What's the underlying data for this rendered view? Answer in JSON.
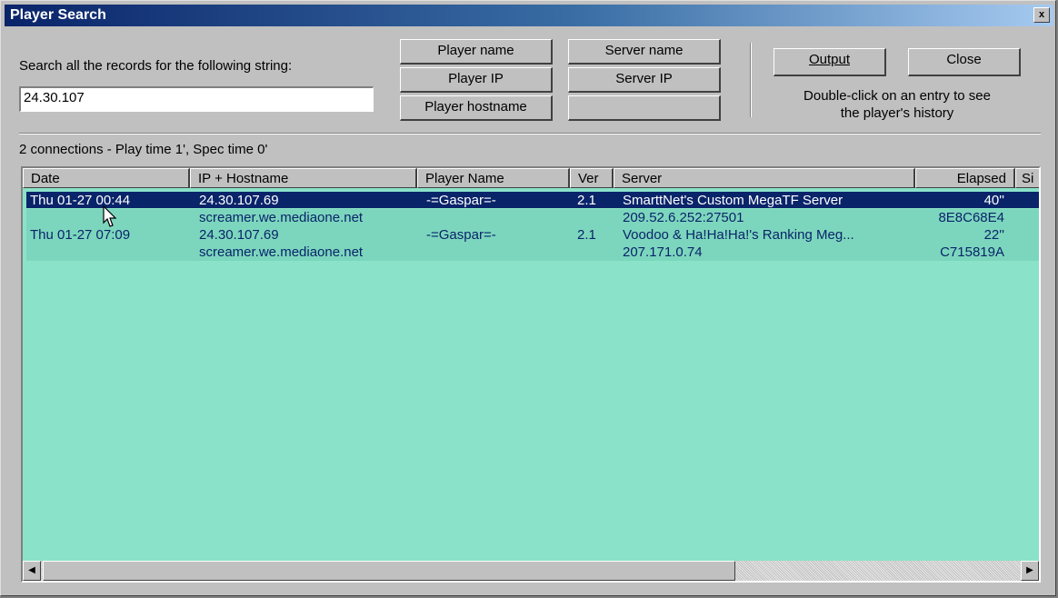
{
  "window": {
    "title": "Player Search",
    "close_glyph": "x"
  },
  "search": {
    "label": "Search all the records for the following string:",
    "value": "24.30.107"
  },
  "buttons": {
    "player_name": "Player name",
    "player_ip": "Player IP",
    "player_hostname": "Player hostname",
    "server_name": "Server name",
    "server_ip": "Server IP",
    "blank": "",
    "output": "Output",
    "close": "Close"
  },
  "hint": "Double-click on an entry to see\nthe player's history",
  "status": "2 connections - Play time 1', Spec time 0'",
  "columns": [
    "Date",
    "IP + Hostname",
    "Player Name",
    "Ver",
    "Server",
    "Elapsed",
    "Si"
  ],
  "rows": [
    {
      "date": "Thu 01-27 00:44",
      "ip": "24.30.107.69",
      "hostname": "screamer.we.mediaone.net",
      "player": "-=Gaspar=-",
      "ver": "2.1",
      "server": "SmarttNet's Custom MegaTF Server",
      "server_ip": "209.52.6.252:27501",
      "elapsed": "40''",
      "id": "8E8C68E4",
      "selected": true
    },
    {
      "date": "Thu 01-27 07:09",
      "ip": "24.30.107.69",
      "hostname": "screamer.we.mediaone.net",
      "player": "-=Gaspar=-",
      "ver": "2.1",
      "server": "Voodoo & Ha!Ha!Ha!'s Ranking Meg...",
      "server_ip": "207.171.0.74",
      "elapsed": "22''",
      "id": "C715819A",
      "selected": false
    }
  ],
  "scrollbar": {
    "left_arrow": "◀",
    "right_arrow": "▶"
  },
  "colors": {
    "list_bg": "#8ae2c8",
    "selection": "#0a246a",
    "title_start": "#0a246a",
    "title_end": "#a6caf0"
  },
  "icons": [
    "close-icon",
    "mouse-cursor-icon",
    "scroll-left-icon",
    "scroll-right-icon"
  ]
}
